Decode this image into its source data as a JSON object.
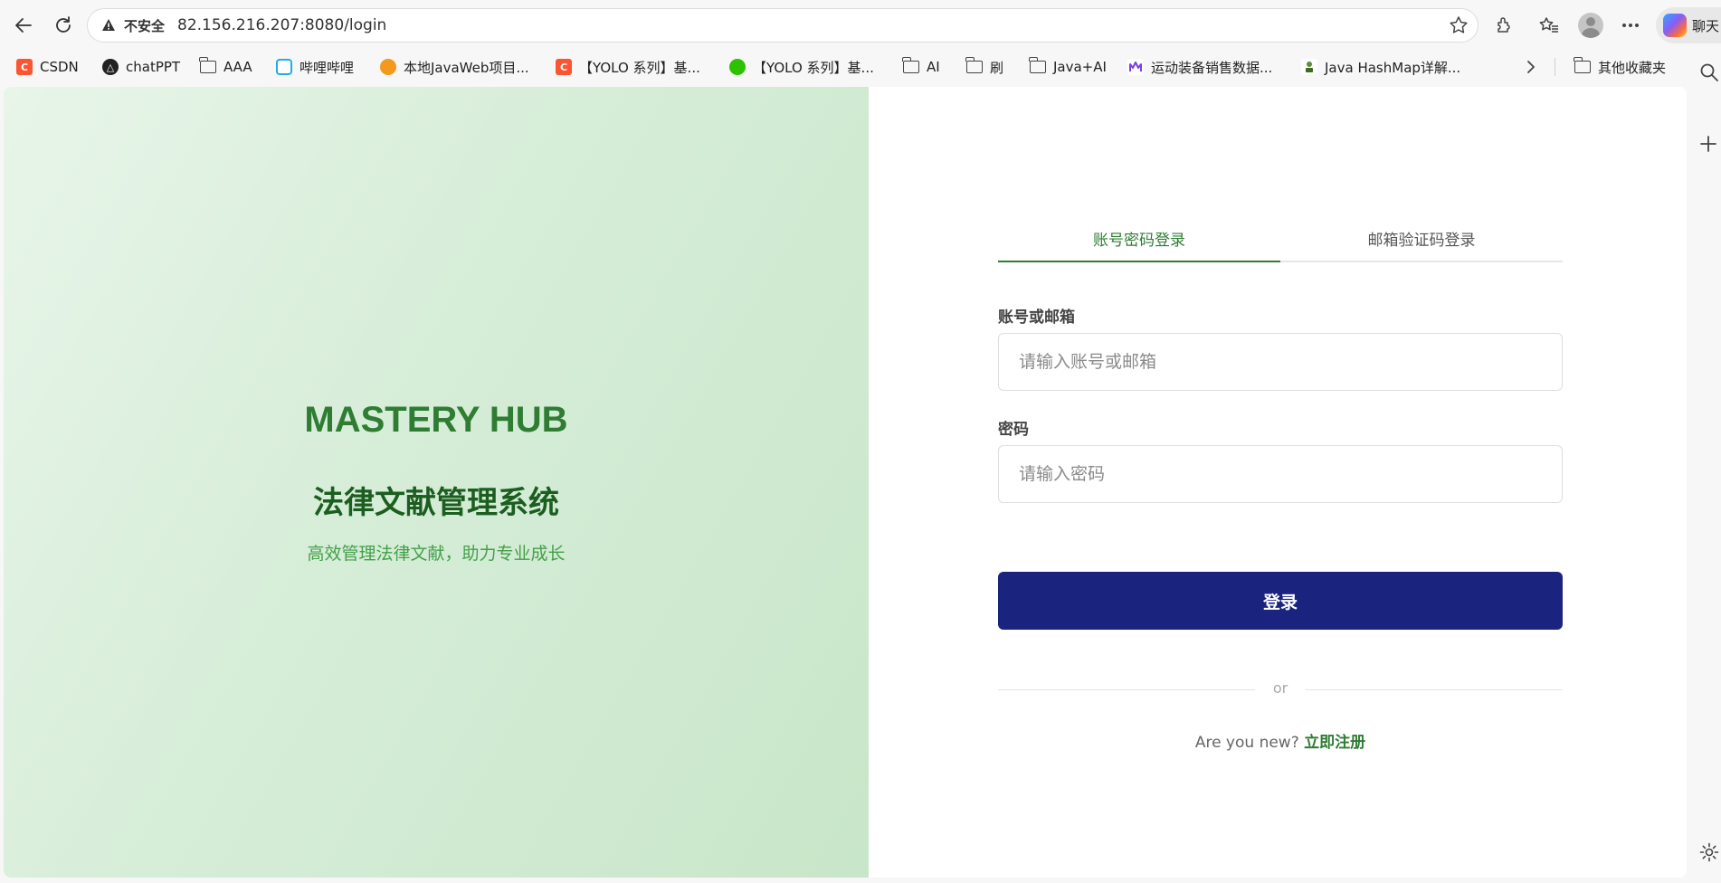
{
  "browser": {
    "insecure_label": "不安全",
    "url": "82.156.216.207:8080/login",
    "copilot_label": "聊天"
  },
  "bookmarks": [
    {
      "label": "CSDN",
      "icon": "csdn-icon"
    },
    {
      "label": "chatPPT",
      "icon": "chatppt-icon"
    },
    {
      "label": "AAA",
      "icon": "folder-icon"
    },
    {
      "label": "哔哩哔哩",
      "icon": "bilibili-icon"
    },
    {
      "label": "本地JavaWeb项目...",
      "icon": "javaweb-icon"
    },
    {
      "label": "【YOLO 系列】基...",
      "icon": "csdn-icon"
    },
    {
      "label": "【YOLO 系列】基...",
      "icon": "wechat-icon"
    },
    {
      "label": "AI",
      "icon": "folder-icon"
    },
    {
      "label": "刷",
      "icon": "folder-icon"
    },
    {
      "label": "Java+AI",
      "icon": "folder-icon"
    },
    {
      "label": "运动装备销售数据...",
      "icon": "sales-icon"
    },
    {
      "label": "Java HashMap详解...",
      "icon": "hashmap-icon"
    },
    {
      "label": "其他收藏夹",
      "icon": "folder-icon"
    }
  ],
  "hero": {
    "title": "MASTERY HUB",
    "subtitle": "法律文献管理系统",
    "tagline": "高效管理法律文献，助力专业成长"
  },
  "login": {
    "tabs": [
      {
        "label": "账号密码登录",
        "active": true
      },
      {
        "label": "邮箱验证码登录",
        "active": false
      }
    ],
    "account_label": "账号或邮箱",
    "account_placeholder": "请输入账号或邮箱",
    "password_label": "密码",
    "password_placeholder": "请输入密码",
    "submit_label": "登录",
    "divider_text": "or",
    "register_prompt": "Are you new?",
    "register_link": "立即注册"
  },
  "colors": {
    "primary_green": "#2e7d32",
    "button_navy": "#1a237e",
    "hero_bg": "#c8e6c9"
  }
}
